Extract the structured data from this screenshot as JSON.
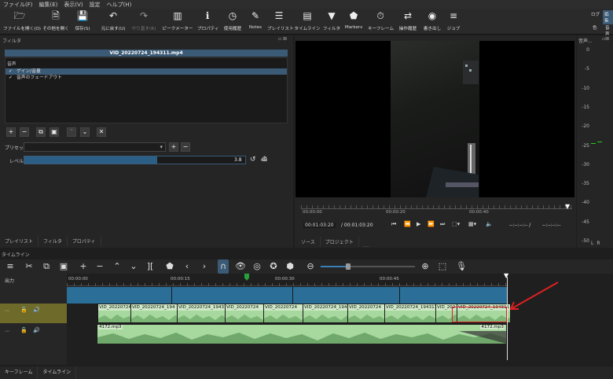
{
  "menubar": [
    "ファイル(F)",
    "編集(E)",
    "表示(V)",
    "設定",
    "ヘルプ(H)"
  ],
  "toolbar": [
    {
      "label": "ファイルを開く(O)",
      "icon": "folder-icon"
    },
    {
      "label": "その他を開く",
      "icon": "open-other-icon"
    },
    {
      "label": "保存(S)",
      "icon": "save-icon"
    },
    {
      "label": "元に戻す(U)",
      "icon": "undo-icon"
    },
    {
      "label": "やり直す(R)",
      "icon": "redo-icon"
    },
    {
      "label": "ピークメーター",
      "icon": "peak-meter-icon"
    },
    {
      "label": "プロパティ",
      "icon": "info-icon"
    },
    {
      "label": "使用履歴",
      "icon": "clock-icon"
    },
    {
      "label": "Notes",
      "icon": "notes-icon"
    },
    {
      "label": "プレイリスト",
      "icon": "list-icon"
    },
    {
      "label": "タイムライン",
      "icon": "timeline-icon"
    },
    {
      "label": "フィルタ",
      "icon": "filter-icon"
    },
    {
      "label": "Markers",
      "icon": "marker-icon"
    },
    {
      "label": "キーフレーム",
      "icon": "stopwatch-icon"
    },
    {
      "label": "操作履歴",
      "icon": "history-icon"
    },
    {
      "label": "書き出し",
      "icon": "export-icon"
    },
    {
      "label": "ジョブ",
      "icon": "jobs-icon"
    }
  ],
  "layouts": {
    "log": "ログ",
    "edit": "編集",
    "color": "色",
    "audio": "音声"
  },
  "filter_panel": {
    "title": "フィルタ",
    "clip_name": "VID_20220724_194311.mp4",
    "section": "音声",
    "filters": [
      {
        "label": "ゲイン/音量",
        "checked": true,
        "selected": true
      },
      {
        "label": "音声のフェードアウト",
        "checked": true,
        "selected": false
      }
    ],
    "preset_label": "プリセット",
    "level_label": "レベル",
    "level_value": "3.8",
    "level_unit": "dB",
    "level_fraction": 0.6
  },
  "left_tabs": [
    "プレイリスト",
    "フィルタ",
    "プロパティ"
  ],
  "player": {
    "ruler_marks": [
      "00:00:00",
      "00:00:20",
      "00:00:40"
    ],
    "current_time": "00:01:03:20",
    "total_time": "/ 00:01:03:20",
    "in_point": "--:--:--:-- /",
    "out_point": "--:--:--:--",
    "tabs": [
      "ソース",
      "プロジェクト"
    ]
  },
  "meter": {
    "title": "音声...",
    "ticks": [
      "0",
      "-5",
      "-10",
      "-15",
      "-20",
      "-25",
      "-30",
      "-35",
      "-40",
      "-45",
      "-50"
    ],
    "channels": [
      "L",
      "R"
    ]
  },
  "timeline": {
    "title": "タイムライン",
    "output_label": "出力",
    "ruler": [
      "00:00:00",
      "00:00:15",
      "00:00:30",
      "00:00:45"
    ],
    "video_clips": [
      "VID_20220724",
      "VID_20220724_194",
      "VID_20220724_19431",
      "VID_20220724",
      "VID_20220724",
      "VID_20220724_194",
      "VID_20220724",
      "VID_20220724_194311",
      "VID_202",
      "VID_20220724_194311"
    ],
    "audio_clip_left": "4172.mp3",
    "audio_clip_right": "4172.mp3"
  },
  "bottom_tabs": [
    "キーフレーム",
    "タイムライン"
  ],
  "colors": {
    "accent": "#3b5a75",
    "clip": "#a7d89e",
    "video_track": "#2b6e98",
    "annotation_arrow": "#e02020"
  }
}
